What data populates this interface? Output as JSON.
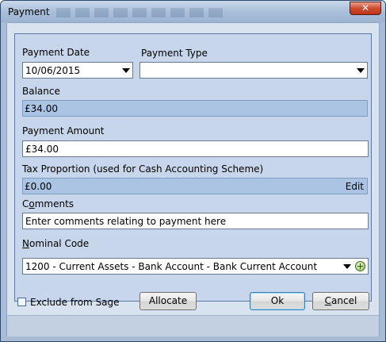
{
  "window": {
    "title": "Payment",
    "close_label": "✕"
  },
  "form": {
    "payment_date": {
      "label": "Payment Date",
      "value": "10/06/2015"
    },
    "payment_type": {
      "label": "Payment Type",
      "value": ""
    },
    "balance": {
      "label": "Balance",
      "value": "£34.00"
    },
    "payment_amount": {
      "label": "Payment Amount",
      "value": "£34.00"
    },
    "tax_proportion": {
      "label": "Tax Proportion (used for Cash Accounting Scheme)",
      "value": "£0.00",
      "edit_label": "Edit"
    },
    "comments": {
      "label_prefix": "C",
      "label_accel": "o",
      "label_rest": "mments",
      "value": "Enter comments relating to payment here"
    },
    "nominal_code": {
      "label_accel": "N",
      "label_rest": "ominal Code",
      "value": "1200 - Current Assets - Bank Account - Bank Current Account"
    }
  },
  "footer": {
    "exclude_label": "Exclude from Sage",
    "exclude_checked": false,
    "allocate_label": "Allocate",
    "ok_label": "Ok",
    "cancel_accel": "C",
    "cancel_rest": "ancel"
  }
}
